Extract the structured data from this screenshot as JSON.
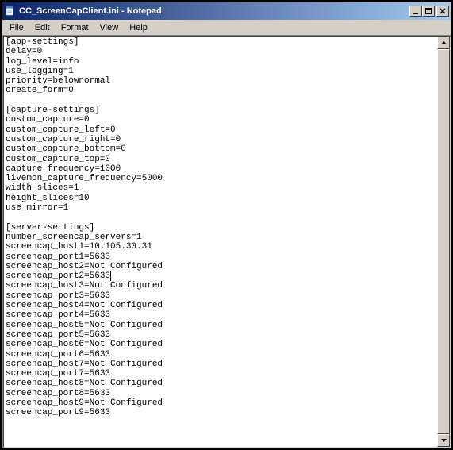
{
  "window": {
    "title": "CC_ScreenCapClient.ini - Notepad"
  },
  "menu": {
    "file": "File",
    "edit": "Edit",
    "format": "Format",
    "view": "View",
    "help": "Help"
  },
  "content": {
    "lines": [
      "[app-settings]",
      "delay=0",
      "log_level=info",
      "use_logging=1",
      "priority=belownormal",
      "create_form=0",
      "",
      "[capture-settings]",
      "custom_capture=0",
      "custom_capture_left=0",
      "custom_capture_right=0",
      "custom_capture_bottom=0",
      "custom_capture_top=0",
      "capture_frequency=1000",
      "livemon_capture_frequency=5000",
      "width_slices=1",
      "height_slices=10",
      "use_mirror=1",
      "",
      "[server-settings]",
      "number_screencap_servers=1",
      "screencap_host1=10.105.30.31",
      "screencap_port1=5633",
      "screencap_host2=Not Configured",
      "screencap_port2=5633",
      "screencap_host3=Not Configured",
      "screencap_port3=5633",
      "screencap_host4=Not Configured",
      "screencap_port4=5633",
      "screencap_host5=Not Configured",
      "screencap_port5=5633",
      "screencap_host6=Not Configured",
      "screencap_port6=5633",
      "screencap_host7=Not Configured",
      "screencap_port7=5633",
      "screencap_host8=Not Configured",
      "screencap_port8=5633",
      "screencap_host9=Not Configured",
      "screencap_port9=5633"
    ],
    "caret_line": 24,
    "caret_col": 20
  }
}
